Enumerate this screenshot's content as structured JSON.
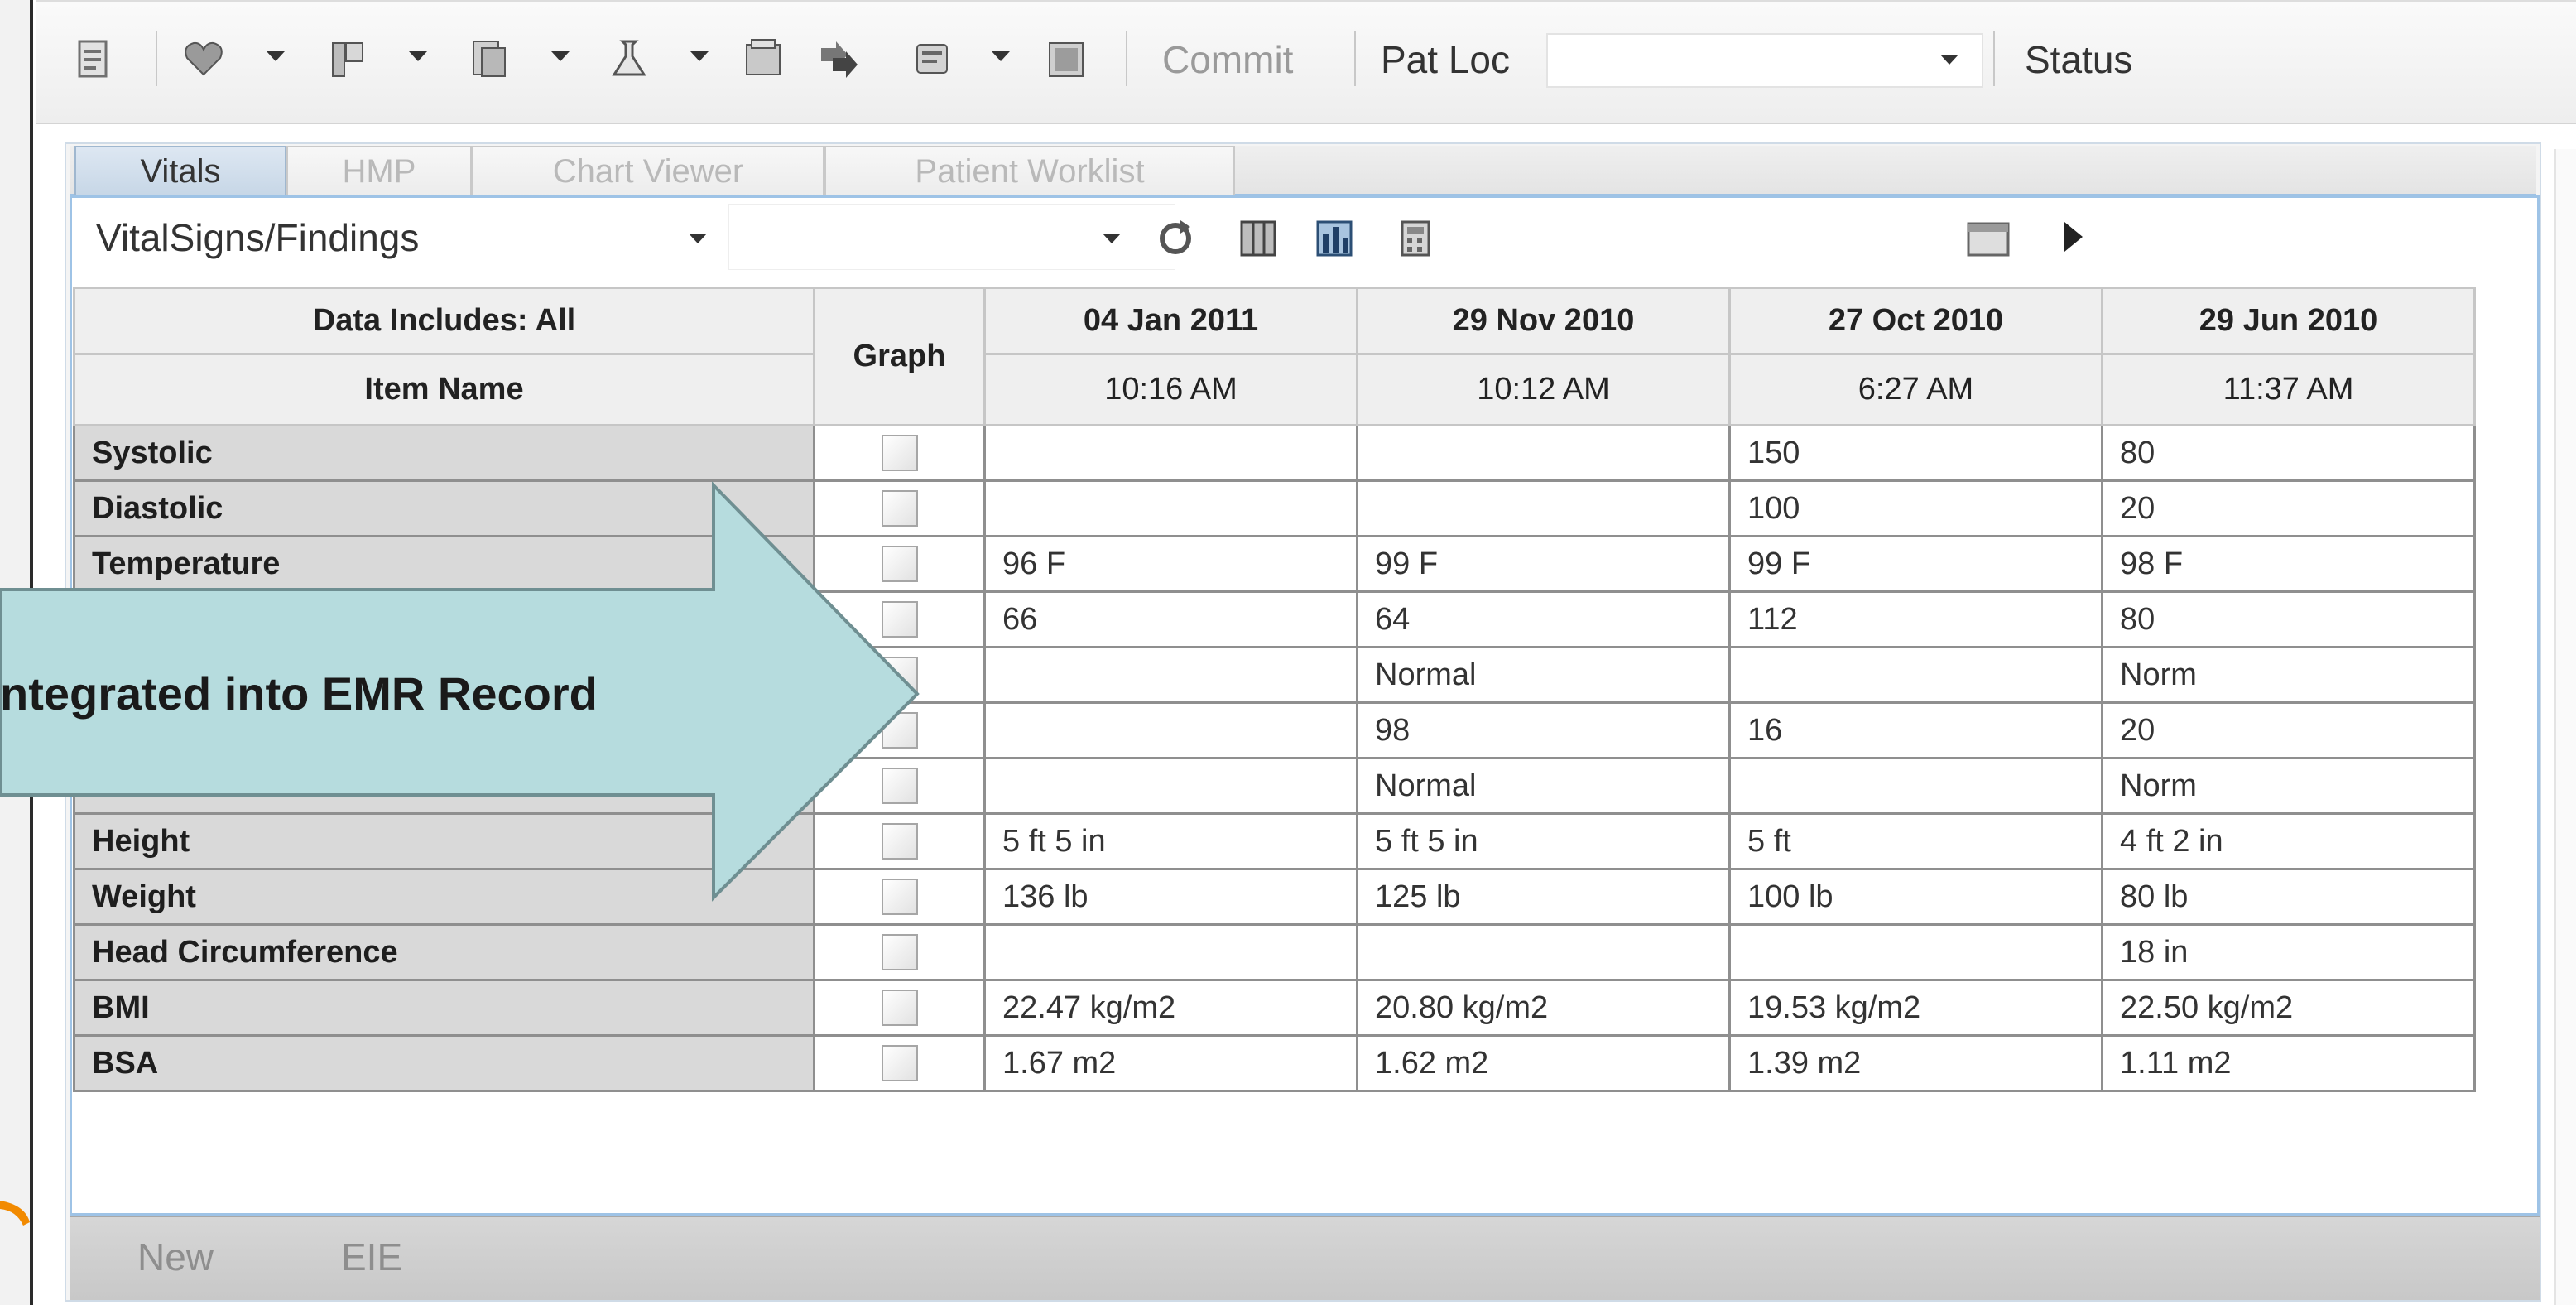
{
  "toolbar": {
    "commit_label": "Commit",
    "patloc_label": "Pat Loc",
    "patloc_value": "",
    "status_label": "Status"
  },
  "tabs": [
    {
      "label": "Vitals",
      "active": true
    },
    {
      "label": "HMP",
      "active": false
    },
    {
      "label": "Chart Viewer",
      "active": false
    },
    {
      "label": "Patient Worklist",
      "active": false
    }
  ],
  "view": {
    "selected": "VitalSigns/Findings"
  },
  "grid": {
    "data_includes": "Data Includes: All",
    "item_name_header": "Item Name",
    "graph_header": "Graph",
    "columns": [
      {
        "date": "04 Jan 2011",
        "time": "10:16 AM"
      },
      {
        "date": "29 Nov 2010",
        "time": "10:12 AM"
      },
      {
        "date": "27 Oct 2010",
        "time": "6:27 AM"
      },
      {
        "date": "29 Jun 2010",
        "time": "11:37 AM"
      }
    ],
    "rows": [
      {
        "name": "Systolic",
        "values": [
          "",
          "",
          "150",
          "80"
        ]
      },
      {
        "name": "Diastolic",
        "values": [
          "",
          "",
          "100",
          "20"
        ]
      },
      {
        "name": "Temperature",
        "values": [
          "96 F",
          "99 F",
          "99 F",
          "98 F"
        ]
      },
      {
        "name": "",
        "values": [
          "66",
          "64",
          "112",
          "80"
        ]
      },
      {
        "name": "",
        "values": [
          "",
          "Normal",
          "",
          "Norm"
        ]
      },
      {
        "name": "",
        "values": [
          "",
          "98",
          "16",
          "20"
        ]
      },
      {
        "name": "",
        "values": [
          "",
          "Normal",
          "",
          "Norm"
        ]
      },
      {
        "name": "Height",
        "values": [
          "5 ft 5 in",
          "5 ft 5 in",
          "5 ft",
          "4 ft 2 in"
        ]
      },
      {
        "name": "Weight",
        "values": [
          "136 lb",
          "125 lb",
          "100 lb",
          "80 lb"
        ]
      },
      {
        "name": "Head Circumference",
        "values": [
          "",
          "",
          "",
          "18 in"
        ]
      },
      {
        "name": "BMI",
        "values": [
          "22.47 kg/m2",
          "20.80 kg/m2",
          "19.53 kg/m2",
          "22.50 kg/m2"
        ]
      },
      {
        "name": "BSA",
        "values": [
          "1.67 m2",
          "1.62 m2",
          "1.39 m2",
          "1.11 m2"
        ]
      }
    ]
  },
  "bottom": {
    "new_label": "New",
    "eie_label": "EIE"
  },
  "callout": {
    "text": "ntegrated into EMR Record"
  },
  "colors": {
    "callout_fill": "#b6dcde",
    "data_includes": "#ff2a2a",
    "panel_border": "#9ec3e6"
  },
  "icons": [
    "document-icon",
    "heart-icon",
    "vitals-icon",
    "notes-icon",
    "lab-icon",
    "records-icon",
    "forward-icon",
    "orders-icon",
    "report-icon",
    "refresh-icon",
    "columns-icon",
    "graph-icon",
    "calculator-icon",
    "calendar-icon",
    "play-icon"
  ]
}
